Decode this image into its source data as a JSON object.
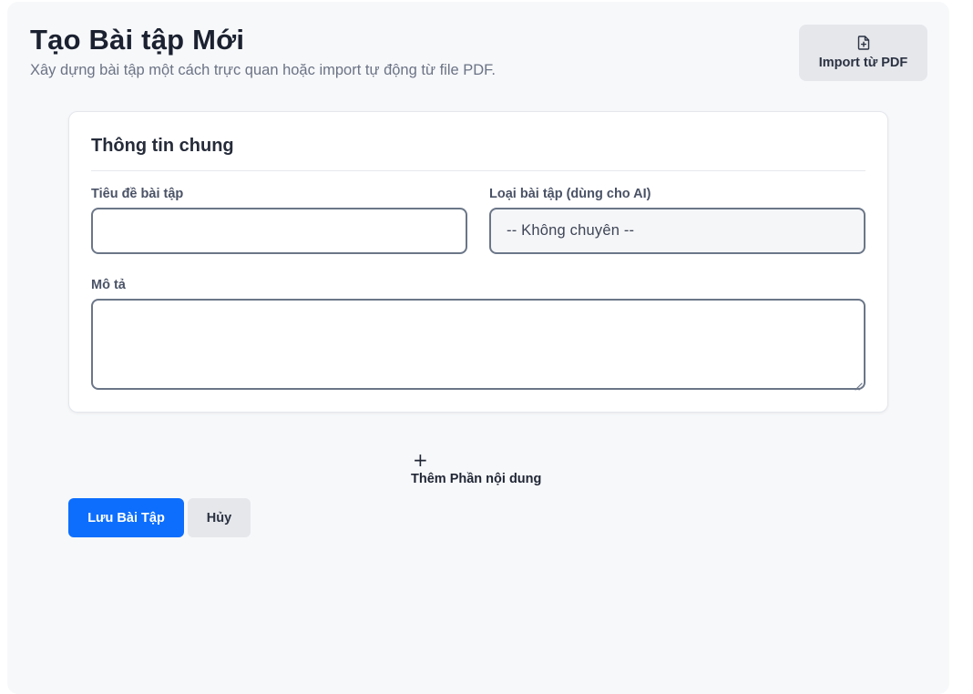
{
  "header": {
    "title": "Tạo Bài tập Mới",
    "subtitle": "Xây dựng bài tập một cách trực quan hoặc import tự động từ file PDF.",
    "import_button": {
      "label": "Import từ PDF",
      "icon": "file-plus-icon"
    }
  },
  "general_info": {
    "title": "Thông tin chung",
    "title_field": {
      "label": "Tiêu đề bài tập",
      "value": "",
      "placeholder": ""
    },
    "type_field": {
      "label": "Loại bài tập (dùng cho AI)",
      "selected": "-- Không chuyên --"
    },
    "description_field": {
      "label": "Mô tả",
      "value": ""
    }
  },
  "add_section": {
    "icon": "plus-icon",
    "label": "Thêm Phần nội dung"
  },
  "actions": {
    "save_label": "Lưu Bài Tập",
    "cancel_label": "Hủy"
  },
  "colors": {
    "primary": "#0d6efd",
    "secondary_bg": "#e5e7eb",
    "page_bg": "#f7f8fa",
    "input_border": "#6b7688"
  }
}
